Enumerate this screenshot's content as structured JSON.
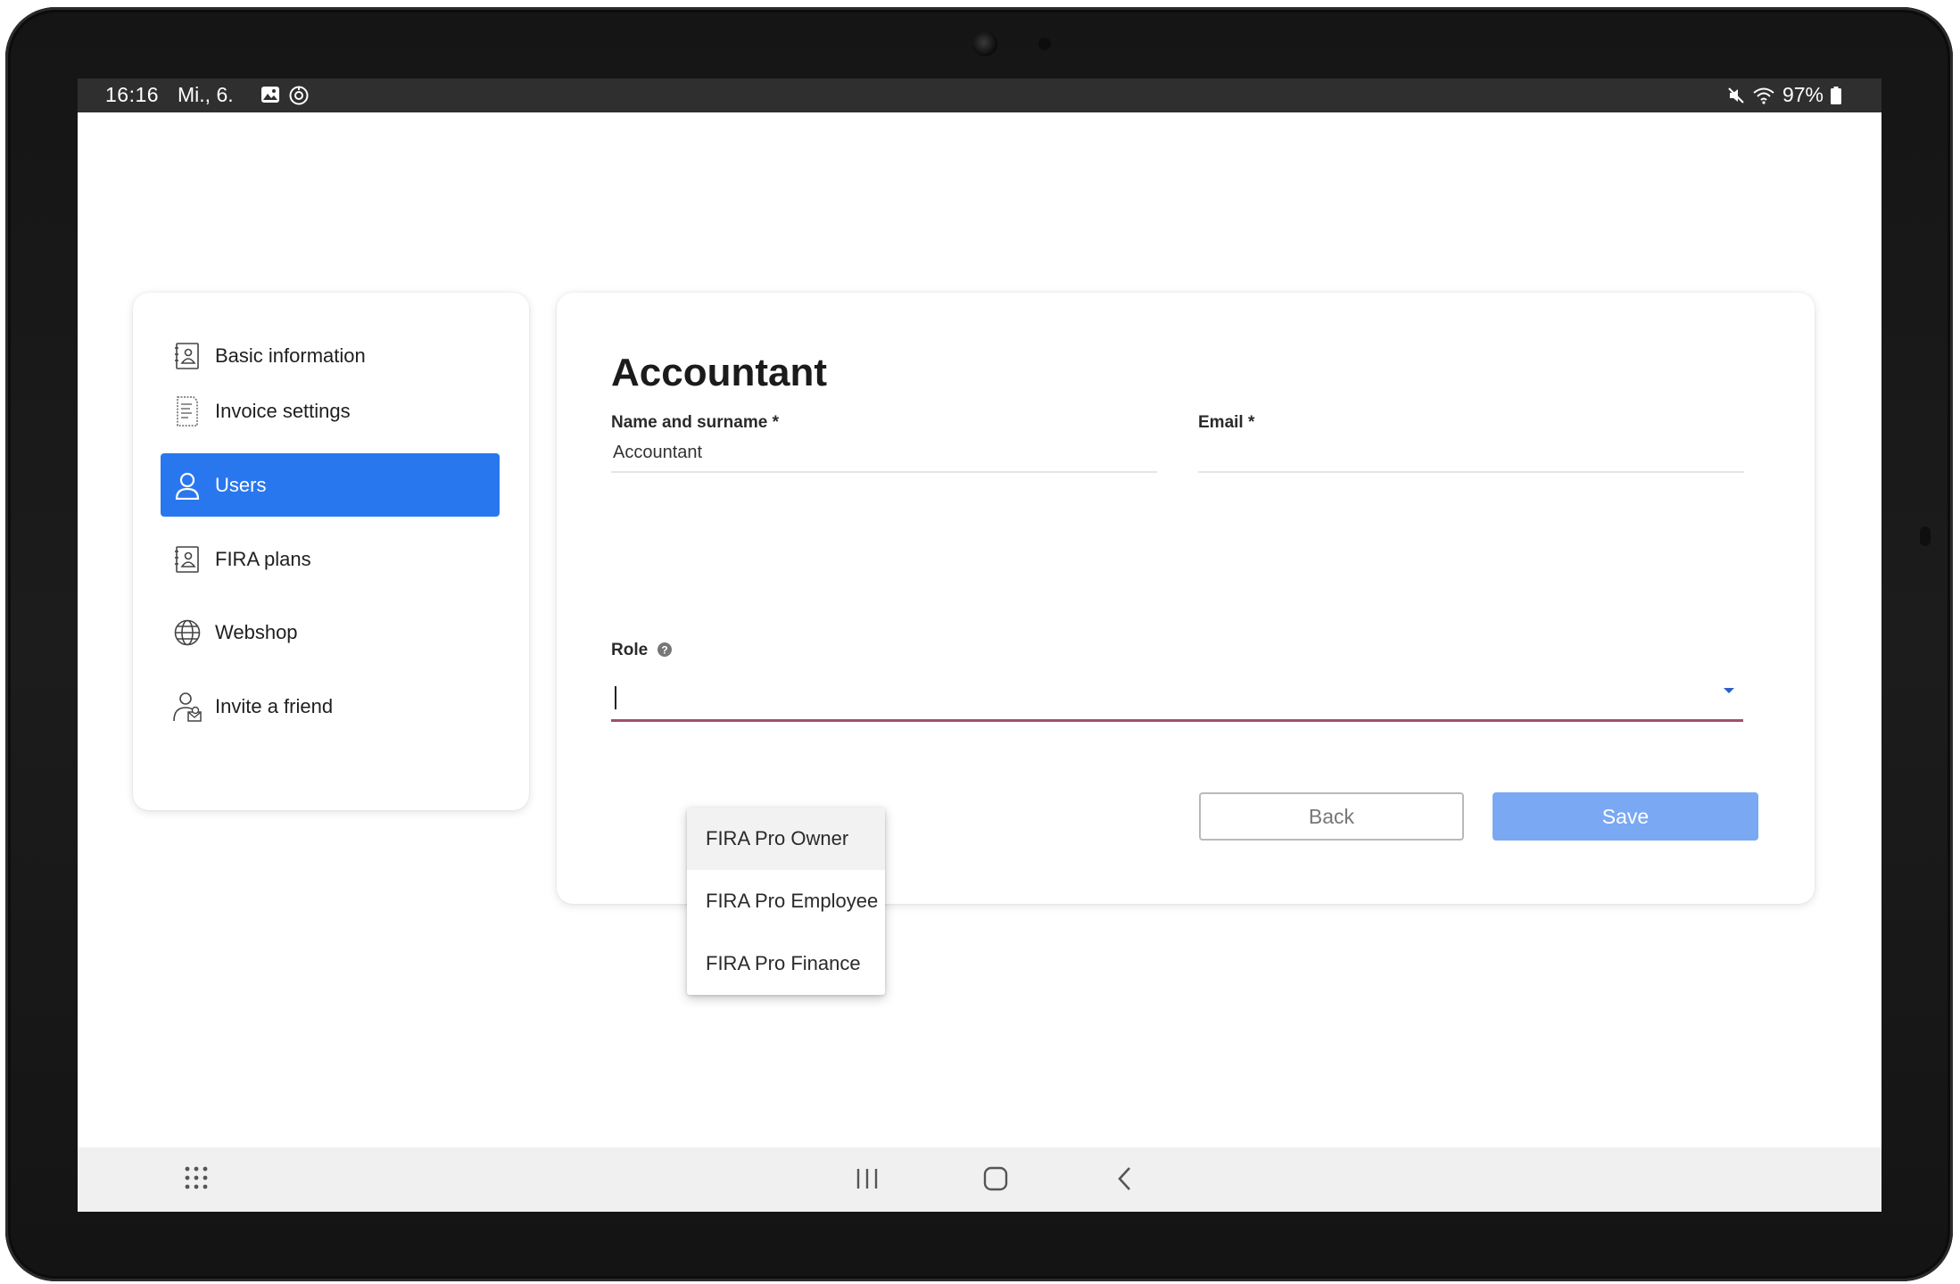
{
  "status_bar": {
    "time": "16:16",
    "date": "Mi., 6.",
    "battery": "97%",
    "icons_left": [
      "gallery-icon",
      "sync-icon"
    ],
    "icons_right": [
      "mute-icon",
      "wifi-icon",
      "battery-icon"
    ]
  },
  "sidebar": {
    "items": [
      {
        "label": "Basic information",
        "icon": "contact-card-icon",
        "active": false
      },
      {
        "label": "Invoice settings",
        "icon": "invoice-icon",
        "active": false
      },
      {
        "label": "Users",
        "icon": "user-icon",
        "active": true
      },
      {
        "label": "FIRA plans",
        "icon": "contact-card-icon",
        "active": false
      },
      {
        "label": "Webshop",
        "icon": "globe-icon",
        "active": false
      },
      {
        "label": "Invite a friend",
        "icon": "invite-user-icon",
        "active": false
      }
    ]
  },
  "form": {
    "title": "Accountant",
    "name_label": "Name and surname *",
    "name_value": "Accountant",
    "email_label": "Email *",
    "email_value": "",
    "role_label": "Role",
    "role_value": "",
    "back_label": "Back",
    "save_label": "Save"
  },
  "role_menu": {
    "options": [
      "FIRA Pro Owner",
      "FIRA Pro Employee",
      "FIRA Pro Finance"
    ],
    "highlighted_index": 0
  },
  "colors": {
    "accent": "#2977ef",
    "save_button": "#7aa8f3",
    "role_underline": "#a0526a",
    "status_bar": "#2f2f2f"
  }
}
